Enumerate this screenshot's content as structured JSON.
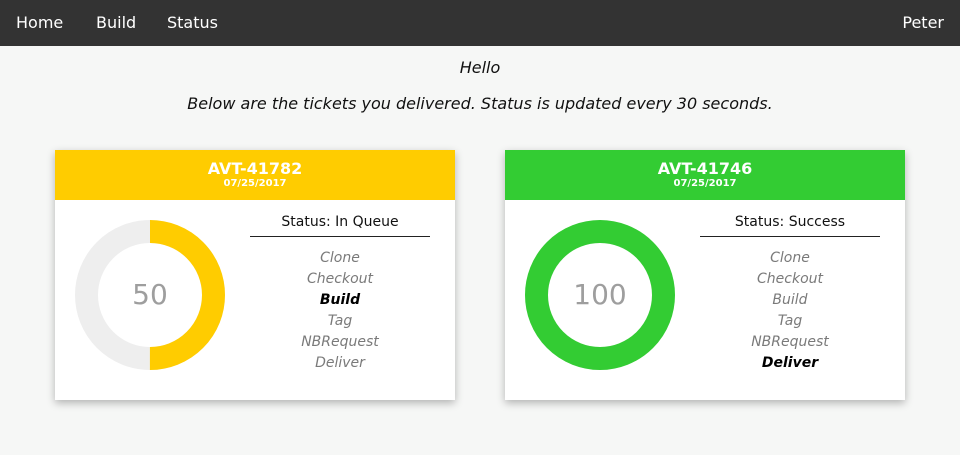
{
  "nav": {
    "home": "Home",
    "build": "Build",
    "status": "Status",
    "user": "Peter"
  },
  "greeting": "Hello",
  "subtitle": "Below are the tickets you delivered. Status is updated every 30 seconds.",
  "tickets": [
    {
      "id": "AVT-41782",
      "date": "07/25/2017",
      "color": "#ffcc00",
      "progress": 50,
      "status": "Status: In Queue",
      "steps": [
        "Clone",
        "Checkout",
        "Build",
        "Tag",
        "NBRequest",
        "Deliver"
      ],
      "active_step": 2
    },
    {
      "id": "AVT-41746",
      "date": "07/25/2017",
      "color": "#33cc33",
      "progress": 100,
      "status": "Status: Success",
      "steps": [
        "Clone",
        "Checkout",
        "Build",
        "Tag",
        "NBRequest",
        "Deliver"
      ],
      "active_step": 5
    }
  ],
  "colors": {
    "navbar": "#333333",
    "track": "#eeeeee"
  }
}
